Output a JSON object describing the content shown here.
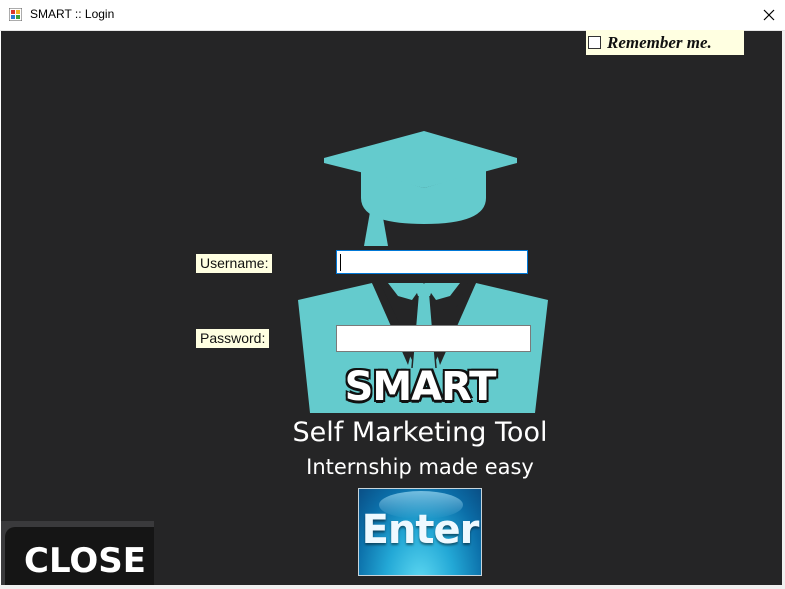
{
  "window": {
    "title": "SMART :: Login",
    "close_icon": "close-icon",
    "app_icon": "app-window-icon"
  },
  "remember": {
    "label": "Remember me.",
    "checked": false
  },
  "logo": {
    "icon": "graduate-logo-icon",
    "brand": "SMART",
    "subtitle": "Self Marketing Tool",
    "tagline": "Internship made easy"
  },
  "form": {
    "username_label": "Username:",
    "username_value": "",
    "password_label": "Password:",
    "password_value": ""
  },
  "buttons": {
    "enter": "Enter",
    "close": "CLOSE"
  },
  "colors": {
    "background": "#252526",
    "logo_teal": "#64cbcd",
    "label_background": "#ffffe1",
    "enter_blue": "#1a8fc4"
  }
}
